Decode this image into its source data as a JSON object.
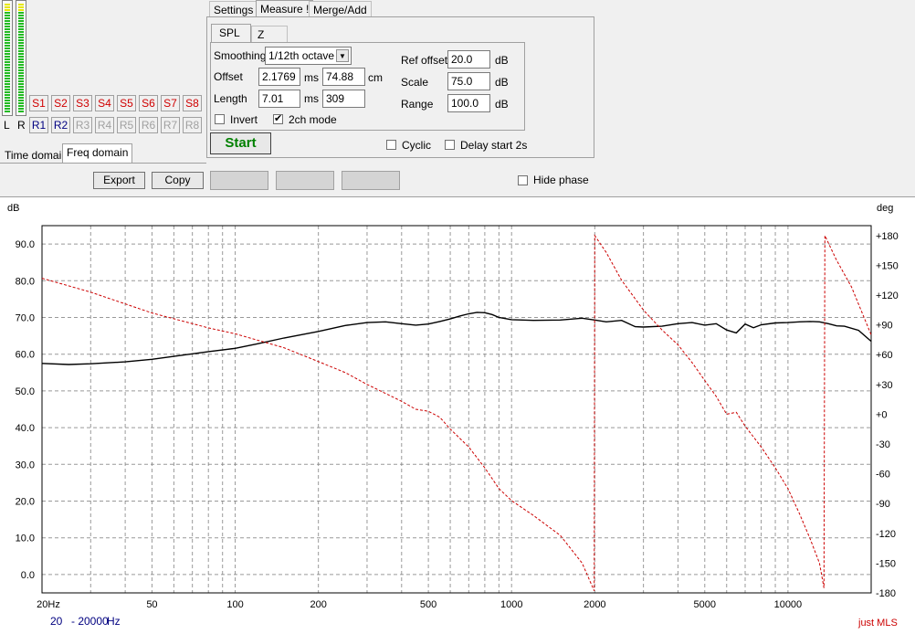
{
  "vu": {
    "left_label": "L",
    "right_label": "R"
  },
  "memory": {
    "s_buttons": [
      "S1",
      "S2",
      "S3",
      "S4",
      "S5",
      "S6",
      "S7",
      "S8"
    ],
    "r_buttons": [
      "R1",
      "R2",
      "R3",
      "R4",
      "R5",
      "R6",
      "R7",
      "R8"
    ]
  },
  "domain_tabs": {
    "time": "Time domain",
    "freq": "Freq domain"
  },
  "main_tabs": {
    "settings": "Settings",
    "measure": "Measure !",
    "merge": "Merge/Add"
  },
  "sub_tabs": {
    "spl": "SPL",
    "z": "Z"
  },
  "form": {
    "smoothing_label": "Smoothing",
    "smoothing_value": "1/12th octave",
    "offset_label": "Offset",
    "offset_ms": "2.1769",
    "offset_ms_unit": "ms",
    "offset_cm": "74.88",
    "offset_cm_unit": "cm",
    "length_label": "Length",
    "length_ms": "7.01",
    "length_ms_unit": "ms",
    "length_samples": "309",
    "invert_label": "Invert",
    "twoch_label": "2ch mode",
    "ref_offset_label": "Ref offset",
    "ref_offset_value": "20.0",
    "scale_label": "Scale",
    "scale_value": "75.0",
    "range_label": "Range",
    "range_value": "100.0",
    "db_unit": "dB",
    "start_label": "Start",
    "cyclic_label": "Cyclic",
    "delay_label": "Delay start 2s"
  },
  "checks": {
    "invert": false,
    "twoch": true,
    "cyclic": false,
    "delay": false,
    "hide_phase": false
  },
  "toolbar": {
    "export": "Export",
    "copy": "Copy",
    "hide_phase": "Hide phase"
  },
  "colors": {
    "spl": "#000000",
    "phase": "#cc0000",
    "start": "#008000",
    "grid": "#808080",
    "brand": "#cc0000"
  },
  "plot": {
    "left_unit": "dB",
    "right_unit": "deg",
    "range_from": "20",
    "range_to": "- 20000",
    "range_unit": "Hz",
    "brand": "just MLS"
  },
  "chart_data": {
    "type": "line",
    "x_scale": "log",
    "xlim": [
      20,
      20000
    ],
    "ylim": [
      -5,
      95
    ],
    "y2lim": [
      -180,
      190
    ],
    "x_ticks": [
      {
        "v": 20,
        "label": "20Hz"
      },
      {
        "v": 50,
        "label": "50"
      },
      {
        "v": 100,
        "label": "100"
      },
      {
        "v": 200,
        "label": "200"
      },
      {
        "v": 500,
        "label": "500"
      },
      {
        "v": 1000,
        "label": "1000"
      },
      {
        "v": 2000,
        "label": "2000"
      },
      {
        "v": 5000,
        "label": "5000"
      },
      {
        "v": 10000,
        "label": "10000"
      }
    ],
    "y_ticks": [
      {
        "v": 90,
        "label": "90.0"
      },
      {
        "v": 80,
        "label": "80.0"
      },
      {
        "v": 70,
        "label": "70.0"
      },
      {
        "v": 60,
        "label": "60.0"
      },
      {
        "v": 50,
        "label": "50.0"
      },
      {
        "v": 40,
        "label": "40.0"
      },
      {
        "v": 30,
        "label": "30.0"
      },
      {
        "v": 20,
        "label": "20.0"
      },
      {
        "v": 10,
        "label": "10.0"
      },
      {
        "v": 0,
        "label": "0.0"
      }
    ],
    "y2_ticks": [
      {
        "v": 180,
        "label": "+180"
      },
      {
        "v": 150,
        "label": "+150"
      },
      {
        "v": 120,
        "label": "+120"
      },
      {
        "v": 90,
        "label": "+90"
      },
      {
        "v": 60,
        "label": "+60"
      },
      {
        "v": 30,
        "label": "+30"
      },
      {
        "v": 0,
        "label": "+0"
      },
      {
        "v": -30,
        "label": "-30"
      },
      {
        "v": -60,
        "label": "-60"
      },
      {
        "v": -90,
        "label": "-90"
      },
      {
        "v": -120,
        "label": "-120"
      },
      {
        "v": -150,
        "label": "-150"
      },
      {
        "v": -180,
        "label": "-180"
      }
    ],
    "series": [
      {
        "axis": "left",
        "style": "solid",
        "x": [
          20,
          25,
          30,
          40,
          50,
          60,
          70,
          80,
          100,
          120,
          150,
          200,
          250,
          300,
          350,
          400,
          450,
          500,
          550,
          600,
          650,
          700,
          750,
          800,
          850,
          900,
          1000,
          1200,
          1500,
          1800,
          2000,
          2200,
          2500,
          2800,
          3000,
          3500,
          4000,
          4500,
          5000,
          5500,
          6000,
          6500,
          7000,
          7500,
          8000,
          9000,
          10000,
          11000,
          12000,
          13000,
          14000,
          15000,
          16000,
          18000,
          20000
        ],
        "y": [
          57.5,
          57.2,
          57.4,
          57.9,
          58.6,
          59.4,
          60.1,
          60.7,
          61.6,
          62.8,
          64.4,
          66.2,
          67.8,
          68.6,
          68.8,
          68.3,
          67.9,
          68.2,
          68.9,
          69.6,
          70.4,
          71.0,
          71.4,
          71.3,
          70.8,
          70.0,
          69.4,
          69.2,
          69.3,
          69.8,
          69.3,
          68.8,
          69.2,
          67.5,
          67.4,
          67.6,
          68.3,
          68.6,
          67.9,
          68.3,
          66.6,
          65.8,
          68.2,
          67.2,
          68.0,
          68.5,
          68.6,
          68.8,
          68.9,
          68.8,
          68.3,
          67.7,
          67.6,
          66.5,
          63.5
        ]
      },
      {
        "axis": "right",
        "style": "dashed",
        "x": [
          20,
          30,
          50,
          80,
          100,
          150,
          200,
          250,
          300,
          400,
          450,
          500,
          550,
          600,
          700,
          800,
          900,
          1000,
          1200,
          1500,
          1800,
          1990,
          2000,
          2200,
          2500,
          3000,
          3500,
          4000,
          4500,
          5000,
          5500,
          6000,
          6500,
          7000,
          8000,
          9000,
          10000,
          11000,
          12000,
          13000,
          13500,
          13600,
          15000,
          17000,
          20000
        ],
        "y": [
          137,
          123,
          102,
          87,
          81,
          67,
          53,
          42,
          30,
          13,
          5,
          3,
          -3,
          -15,
          -33,
          -54,
          -75,
          -87,
          -102,
          -122,
          -150,
          -178,
          180,
          163,
          135,
          105,
          85,
          70,
          52,
          34,
          18,
          0,
          2,
          -12,
          -33,
          -54,
          -75,
          -100,
          -125,
          -150,
          -175,
          180,
          155,
          128,
          80
        ]
      }
    ]
  }
}
